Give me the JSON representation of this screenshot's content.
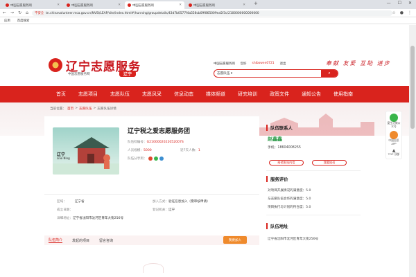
{
  "browser": {
    "tabs": [
      {
        "label": "中国志愿服务网",
        "active": false
      },
      {
        "label": "中国志愿服务网",
        "active": false
      },
      {
        "label": "中国志愿服务网",
        "active": true
      },
      {
        "label": "中国志愿服务网",
        "active": false
      }
    ],
    "address": {
      "insecure_label": "不安全",
      "url": "tn.chinavolunteer.mca.gov.cn/NVSI/LEAP/site/index.html#/hunning/groupdetails/43d7b0577f4a558cb09f865009ea5f3c/2100000000000000"
    },
    "bookmarks": [
      "应用",
      "百度搜索"
    ]
  },
  "header": {
    "title": "辽宁志愿服务",
    "subtitle": "中国志愿服务网",
    "province_badge": "辽宁",
    "toplinks": {
      "site": "中国志愿服务网",
      "welcome": "您好",
      "username": "shibowen0721",
      "logout": "退出"
    },
    "slogan": "奉献 友爱 互助 进步",
    "search": {
      "scope": "志愿队伍 ▾",
      "placeholder": ""
    }
  },
  "nav": {
    "items": [
      "首页",
      "志愿项目",
      "志愿队伍",
      "志愿风采",
      "信息动态",
      "媒体频道",
      "研究培训",
      "政策文件",
      "通知公告",
      "使用指南"
    ]
  },
  "breadcrumb": {
    "prefix": "当前位置：",
    "items": [
      "首页",
      ">",
      "志愿队伍",
      ">",
      "志愿队伍详情"
    ]
  },
  "team": {
    "image_label": "辽宁",
    "image_sub": "Liao Ning",
    "name": "辽宁税之爱志愿服务团",
    "id_label": "队伍标编号：",
    "id_value": "G2100002022052007S",
    "members_label": "人员规模：",
    "members_value": "5000",
    "recent_label": "近7天人数：",
    "recent_value": "1",
    "share_label": "队伍分享到："
  },
  "details": {
    "region_label": "区域：",
    "region_value": "辽宁省",
    "founded_label": "成立日期：",
    "founded_value": "",
    "address_label": "详细地址：",
    "address_value": "辽宁省沈阳市沈河区青年大街256号",
    "join_label": "加入方式：",
    "join_value": "验证信息加入（需审核申请）",
    "authority_label": "登记机关：",
    "authority_value": "辽宁"
  },
  "detail_tabs": {
    "items": [
      "队伍简介",
      "发起的项目",
      "留言咨询"
    ],
    "join_button": "我要加入"
  },
  "contact": {
    "section_title": "队伍联系人",
    "name": "赵鑫鑫",
    "phone_label": "手机：",
    "phone_value": "18604008255",
    "btn_message": "给他发站内信",
    "btn_report": "我要投诉"
  },
  "evaluation": {
    "section_title": "服务评价",
    "lines": [
      {
        "label": "对项目开展情况的满意度：",
        "value": "5.0"
      },
      {
        "label": "与志愿队伍合作的满意度：",
        "value": "5.0"
      },
      {
        "label": "项目执行与计划的符合度：",
        "value": "5.0"
      }
    ]
  },
  "address_section": {
    "section_title": "队伍地址",
    "value": "辽宁省沈阳市沈河区青年大街256号"
  },
  "float": {
    "items": [
      "爱生活微公众号",
      "中国志愿APP",
      "TOP 顶部"
    ]
  },
  "colors": {
    "brand_red": "#d9231d",
    "accent_orange": "#ef8a2c",
    "contact_green": "#2e9b4a"
  }
}
